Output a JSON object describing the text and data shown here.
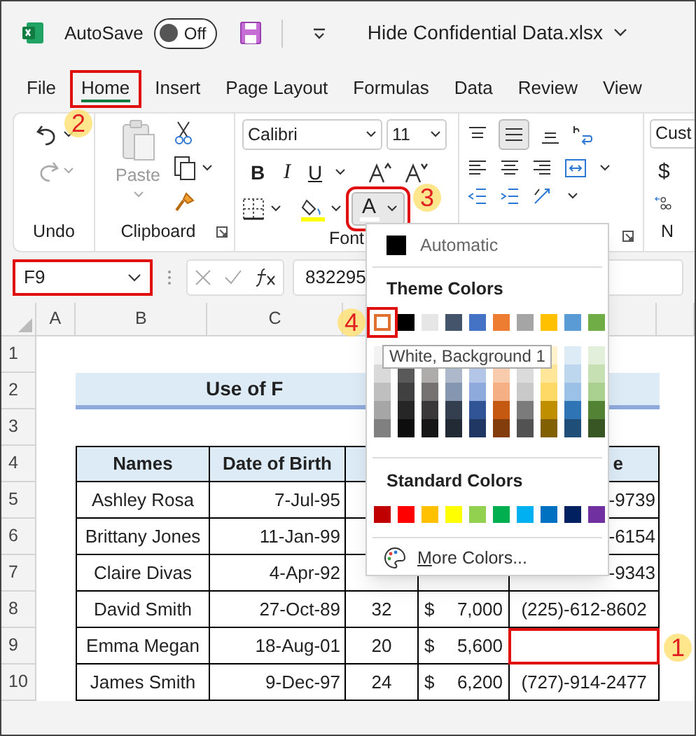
{
  "title_bar": {
    "autosave_label": "AutoSave",
    "autosave_on": false,
    "autosave_state": "Off",
    "file_name": "Hide Confidential Data.xlsx"
  },
  "tabs": [
    {
      "label": "File",
      "selected": false,
      "highlighted": false
    },
    {
      "label": "Home",
      "selected": true,
      "highlighted": true,
      "callout": "2"
    },
    {
      "label": "Insert",
      "selected": false,
      "highlighted": false
    },
    {
      "label": "Page Layout",
      "selected": false,
      "highlighted": false
    },
    {
      "label": "Formulas",
      "selected": false,
      "highlighted": false
    },
    {
      "label": "Data",
      "selected": false,
      "highlighted": false
    },
    {
      "label": "Review",
      "selected": false,
      "highlighted": false
    },
    {
      "label": "View",
      "selected": false,
      "highlighted": false
    }
  ],
  "ribbon": {
    "undo_group": "Undo",
    "paste": "Paste",
    "clipboard_group": "Clipboard",
    "font_name": "Calibri",
    "font_size": "11",
    "font_group": "Font",
    "bold": "B",
    "italic": "I",
    "underline": "U",
    "font_color_button": {
      "label": "A",
      "highlighted": true,
      "callout": "3"
    },
    "number_format": "Cust",
    "currency": "$",
    "number_group": "N"
  },
  "formula_bar": {
    "name_box": "F9",
    "name_box_highlighted": true,
    "value": "832295"
  },
  "columns": [
    "A",
    "B",
    "C"
  ],
  "row_numbers": [
    "1",
    "2",
    "3",
    "4",
    "5",
    "6",
    "7",
    "8",
    "9",
    "10"
  ],
  "sheet": {
    "title": "Use of F",
    "headers": [
      "Names",
      "Date of Birth"
    ],
    "header_tail": "e",
    "rows": [
      {
        "name": "Ashley Rosa",
        "dob": "7-Jul-95",
        "phone_tail": "-9739",
        "highlighted": false
      },
      {
        "name": "Brittany Jones",
        "dob": "11-Jan-99",
        "phone_tail": "-6154",
        "highlighted": false
      },
      {
        "name": "Claire Divas",
        "dob": "4-Apr-92",
        "phone_tail": "-9343",
        "highlighted": false
      },
      {
        "name": "David Smith",
        "dob": "27-Oct-89",
        "age": "32",
        "currency": "$",
        "salary": "7,000",
        "phone": "(225)-612-8602",
        "highlighted": false
      },
      {
        "name": "Emma Megan",
        "dob": "18-Aug-01",
        "age": "20",
        "currency": "$",
        "salary": "5,600",
        "highlighted": true,
        "callout": "1"
      },
      {
        "name": "James Smith",
        "dob": "9-Dec-97",
        "age": "24",
        "currency": "$",
        "salary": "6,200",
        "phone": "(727)-914-2477",
        "highlighted": false
      }
    ]
  },
  "color_menu": {
    "automatic": "Automatic",
    "theme_heading": "Theme Colors",
    "theme_colors": [
      {
        "color": "#ffffff",
        "selected": true,
        "callout": "4",
        "shades": [
          {
            "color": "#f2f2f2"
          },
          {
            "color": "#d9d9d9"
          },
          {
            "color": "#bfbfbf"
          },
          {
            "color": "#a6a6a6"
          },
          {
            "color": "#808080"
          }
        ]
      },
      {
        "color": "#000000",
        "selected": false,
        "shades": [
          {
            "color": "#595959"
          },
          {
            "color": "#404040"
          },
          {
            "color": "#262626"
          },
          {
            "color": "#0d0d0d"
          }
        ]
      },
      {
        "color": "#e7e6e6",
        "selected": false,
        "shades": [
          {
            "color": "#aeabab"
          },
          {
            "color": "#757171"
          },
          {
            "color": "#3a3838"
          },
          {
            "color": "#171616"
          }
        ]
      },
      {
        "color": "#44546a",
        "selected": false,
        "shades": [
          {
            "color": "#adb9ca"
          },
          {
            "color": "#8496b0"
          },
          {
            "color": "#333f4f"
          },
          {
            "color": "#222a35"
          }
        ]
      },
      {
        "color": "#4472c4",
        "selected": false,
        "shades": [
          {
            "color": "#b4c6e7"
          },
          {
            "color": "#8ea9db"
          },
          {
            "color": "#305496"
          },
          {
            "color": "#203764"
          }
        ]
      },
      {
        "color": "#ed7d31",
        "selected": false,
        "shades": [
          {
            "color": "#f8cbad"
          },
          {
            "color": "#f4b084"
          },
          {
            "color": "#c65911"
          },
          {
            "color": "#833c0c"
          }
        ]
      },
      {
        "color": "#a5a5a5",
        "selected": false,
        "shades": [
          {
            "color": "#dbdbdb"
          },
          {
            "color": "#c9c9c9"
          },
          {
            "color": "#7b7b7b"
          },
          {
            "color": "#525252"
          }
        ]
      },
      {
        "color": "#ffc000",
        "selected": false,
        "shades": [
          {
            "color": "#fff2cc"
          },
          {
            "color": "#ffe699"
          },
          {
            "color": "#ffd966"
          },
          {
            "color": "#bf8f00"
          },
          {
            "color": "#806000"
          }
        ]
      },
      {
        "color": "#5b9bd5",
        "selected": false,
        "shades": [
          {
            "color": "#ddebf7"
          },
          {
            "color": "#bdd7ee"
          },
          {
            "color": "#9bc2e6"
          },
          {
            "color": "#2f75b5"
          },
          {
            "color": "#1f4e78"
          }
        ]
      },
      {
        "color": "#70ad47",
        "selected": false,
        "shades": [
          {
            "color": "#e2efda"
          },
          {
            "color": "#c6e0b4"
          },
          {
            "color": "#a9d08e"
          },
          {
            "color": "#548235"
          },
          {
            "color": "#375623"
          }
        ]
      }
    ],
    "tooltip": "White, Background 1",
    "standard_heading": "Standard Colors",
    "standard_colors": [
      {
        "color": "#c00000"
      },
      {
        "color": "#ff0000"
      },
      {
        "color": "#ffc000"
      },
      {
        "color": "#ffff00"
      },
      {
        "color": "#92d050"
      },
      {
        "color": "#00b050"
      },
      {
        "color": "#00b0f0"
      },
      {
        "color": "#0070c0"
      },
      {
        "color": "#002060"
      },
      {
        "color": "#7030a0"
      }
    ],
    "more_colors": "More Colors..."
  }
}
